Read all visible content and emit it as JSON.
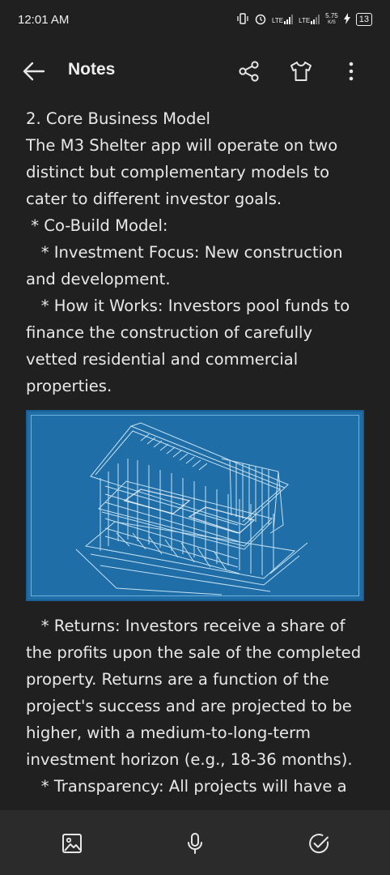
{
  "status": {
    "time": "12:01 AM",
    "net1": "LTE",
    "net2": "LTE",
    "speed_value": "5.75",
    "speed_unit": "K/S",
    "battery": "13"
  },
  "app_bar": {
    "title": "Notes"
  },
  "note": {
    "lines": [
      "2. Core Business Model",
      "The M3 Shelter app will operate on two distinct but complementary models to cater to different investor goals.",
      " * Co-Build Model:",
      "   * Investment Focus: New construction and development.",
      "   * How it Works: Investors pool funds to finance the construction of carefully vetted residential and commercial properties."
    ],
    "image_name": "building-blueprint",
    "lines_after": [
      "   * Returns: Investors receive a share of the profits upon the sale of the completed property. Returns are a function of the project's success and are projected to be higher, with a medium-to-long-term investment horizon (e.g., 18-36 months).",
      "   * Transparency: All projects will have a"
    ]
  },
  "toolbar": {
    "icons": [
      "image-icon",
      "microphone-icon",
      "checklist-icon"
    ]
  },
  "colors": {
    "background": "#202020",
    "toolbar": "#2b2b2b",
    "blueprint": "#1f6ea8"
  }
}
